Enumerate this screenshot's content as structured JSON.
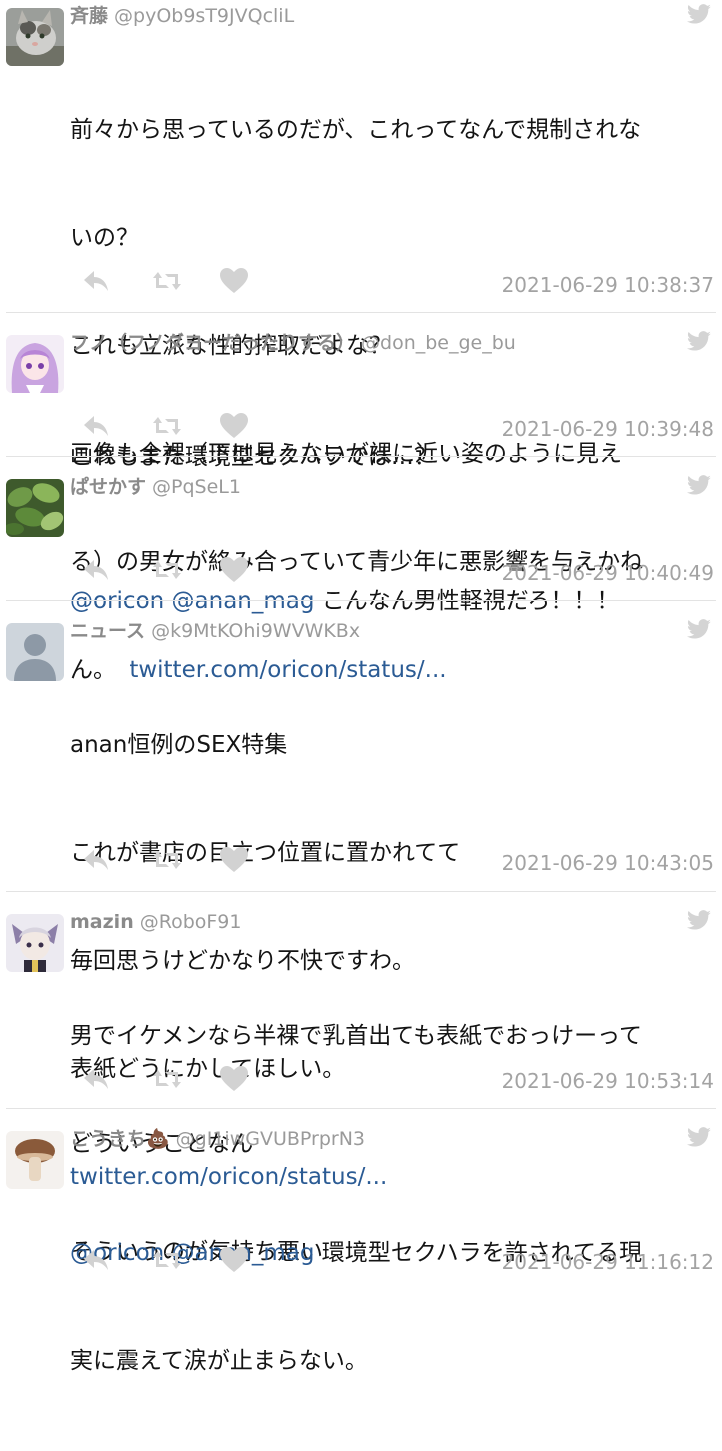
{
  "colors": {
    "link": "#2b5b94",
    "meta": "#9a9a9a",
    "icon": "#d2d2d2"
  },
  "tweets": [
    {
      "name": "斉藤",
      "handle": "@pyOb9sT9JVQcliL",
      "lines": [
        "前々から思っているのだが、これってなんで規制されな",
        "いの？",
        "これも立派な性的搾取だよな？",
        "画像も全裸（下は見えないが裸に近い姿のように見え",
        "る）の男女が絡み合っていて青少年に悪影響を与えかね"
      ],
      "last_text": "ん。",
      "link": "twitter.com/oricon/status/...",
      "time": "2021-06-29 10:38:37"
    },
    {
      "name": "フノ（フノダヨーだったりする）",
      "handle": "@don_be_ge_bu",
      "text": "これもまた環境型セクハラでは…？",
      "time": "2021-06-29 10:39:48"
    },
    {
      "name": "ぱせかす",
      "handle": "@PqSeL1",
      "mention1": "@oricon",
      "mention2": "@anan_mag",
      "text": "こんなん男性軽視だろ！！！",
      "time": "2021-06-29 10:40:49"
    },
    {
      "name": "ニュース",
      "handle": "@k9MtKOhi9WVWKBx",
      "lines": [
        "anan恒例のSEX特集",
        "これが書店の目立つ位置に置かれてて",
        "毎回思うけどかなり不快ですわ。",
        "表紙どうにかしてほしい。"
      ],
      "link": "twitter.com/oricon/status/...",
      "time": "2021-06-29 10:43:05"
    },
    {
      "name": "mazin",
      "handle": "@RoboF91",
      "lines": [
        "男でイケメンなら半裸で乳首出ても表紙でおっけーって",
        "どういうことなん",
        "そういうのが気持ち悪い"
      ],
      "time": "2021-06-29 10:53:14"
    },
    {
      "name": "こうきち💩",
      "handle": "@gI1iwGVUBPrprN3",
      "mention1": "@oricon",
      "mention2": "@anan_mag",
      "text_first": "環境型セクハラを許されてる現",
      "text_second": "実に震えて涙が止まらない。",
      "time": "2021-06-29 11:16:12"
    }
  ]
}
